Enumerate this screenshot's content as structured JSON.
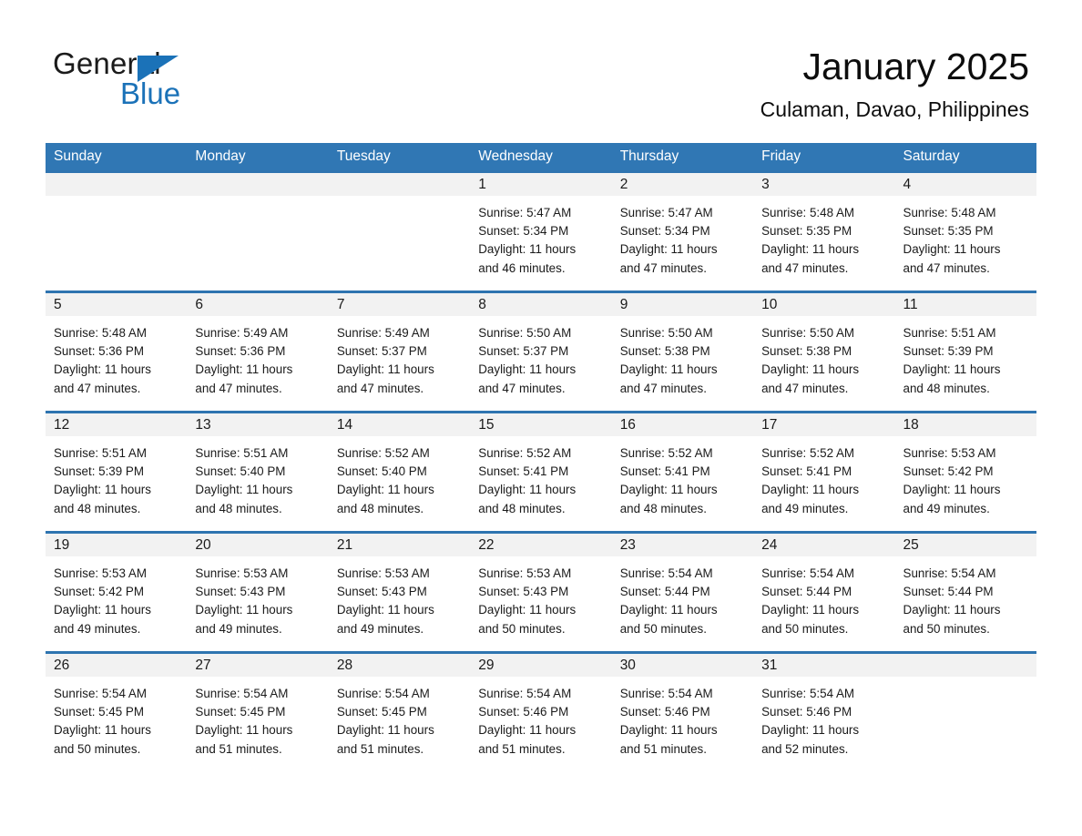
{
  "brand": {
    "line1": "General",
    "line2": "Blue",
    "triangle_icon": "brand-triangle-icon",
    "color_dark": "#1b1b1b",
    "color_blue": "#1b72b8"
  },
  "header": {
    "month_title": "January 2025",
    "location": "Culaman, Davao, Philippines"
  },
  "theme": {
    "header_blue": "#3077b4",
    "row_divider_blue": "#2e74b0",
    "daynum_band": "#f2f2f2",
    "text": "#1a1a1a"
  },
  "weekdays": [
    "Sunday",
    "Monday",
    "Tuesday",
    "Wednesday",
    "Thursday",
    "Friday",
    "Saturday"
  ],
  "labels": {
    "sunrise_prefix": "Sunrise:",
    "sunset_prefix": "Sunset:",
    "daylight_prefix": "Daylight:"
  },
  "weeks": [
    [
      {
        "day": "",
        "line1": "",
        "line2": "",
        "line3": "",
        "line4": ""
      },
      {
        "day": "",
        "line1": "",
        "line2": "",
        "line3": "",
        "line4": ""
      },
      {
        "day": "",
        "line1": "",
        "line2": "",
        "line3": "",
        "line4": ""
      },
      {
        "day": "1",
        "line1": "Sunrise: 5:47 AM",
        "line2": "Sunset: 5:34 PM",
        "line3": "Daylight: 11 hours",
        "line4": "and 46 minutes."
      },
      {
        "day": "2",
        "line1": "Sunrise: 5:47 AM",
        "line2": "Sunset: 5:34 PM",
        "line3": "Daylight: 11 hours",
        "line4": "and 47 minutes."
      },
      {
        "day": "3",
        "line1": "Sunrise: 5:48 AM",
        "line2": "Sunset: 5:35 PM",
        "line3": "Daylight: 11 hours",
        "line4": "and 47 minutes."
      },
      {
        "day": "4",
        "line1": "Sunrise: 5:48 AM",
        "line2": "Sunset: 5:35 PM",
        "line3": "Daylight: 11 hours",
        "line4": "and 47 minutes."
      }
    ],
    [
      {
        "day": "5",
        "line1": "Sunrise: 5:48 AM",
        "line2": "Sunset: 5:36 PM",
        "line3": "Daylight: 11 hours",
        "line4": "and 47 minutes."
      },
      {
        "day": "6",
        "line1": "Sunrise: 5:49 AM",
        "line2": "Sunset: 5:36 PM",
        "line3": "Daylight: 11 hours",
        "line4": "and 47 minutes."
      },
      {
        "day": "7",
        "line1": "Sunrise: 5:49 AM",
        "line2": "Sunset: 5:37 PM",
        "line3": "Daylight: 11 hours",
        "line4": "and 47 minutes."
      },
      {
        "day": "8",
        "line1": "Sunrise: 5:50 AM",
        "line2": "Sunset: 5:37 PM",
        "line3": "Daylight: 11 hours",
        "line4": "and 47 minutes."
      },
      {
        "day": "9",
        "line1": "Sunrise: 5:50 AM",
        "line2": "Sunset: 5:38 PM",
        "line3": "Daylight: 11 hours",
        "line4": "and 47 minutes."
      },
      {
        "day": "10",
        "line1": "Sunrise: 5:50 AM",
        "line2": "Sunset: 5:38 PM",
        "line3": "Daylight: 11 hours",
        "line4": "and 47 minutes."
      },
      {
        "day": "11",
        "line1": "Sunrise: 5:51 AM",
        "line2": "Sunset: 5:39 PM",
        "line3": "Daylight: 11 hours",
        "line4": "and 48 minutes."
      }
    ],
    [
      {
        "day": "12",
        "line1": "Sunrise: 5:51 AM",
        "line2": "Sunset: 5:39 PM",
        "line3": "Daylight: 11 hours",
        "line4": "and 48 minutes."
      },
      {
        "day": "13",
        "line1": "Sunrise: 5:51 AM",
        "line2": "Sunset: 5:40 PM",
        "line3": "Daylight: 11 hours",
        "line4": "and 48 minutes."
      },
      {
        "day": "14",
        "line1": "Sunrise: 5:52 AM",
        "line2": "Sunset: 5:40 PM",
        "line3": "Daylight: 11 hours",
        "line4": "and 48 minutes."
      },
      {
        "day": "15",
        "line1": "Sunrise: 5:52 AM",
        "line2": "Sunset: 5:41 PM",
        "line3": "Daylight: 11 hours",
        "line4": "and 48 minutes."
      },
      {
        "day": "16",
        "line1": "Sunrise: 5:52 AM",
        "line2": "Sunset: 5:41 PM",
        "line3": "Daylight: 11 hours",
        "line4": "and 48 minutes."
      },
      {
        "day": "17",
        "line1": "Sunrise: 5:52 AM",
        "line2": "Sunset: 5:41 PM",
        "line3": "Daylight: 11 hours",
        "line4": "and 49 minutes."
      },
      {
        "day": "18",
        "line1": "Sunrise: 5:53 AM",
        "line2": "Sunset: 5:42 PM",
        "line3": "Daylight: 11 hours",
        "line4": "and 49 minutes."
      }
    ],
    [
      {
        "day": "19",
        "line1": "Sunrise: 5:53 AM",
        "line2": "Sunset: 5:42 PM",
        "line3": "Daylight: 11 hours",
        "line4": "and 49 minutes."
      },
      {
        "day": "20",
        "line1": "Sunrise: 5:53 AM",
        "line2": "Sunset: 5:43 PM",
        "line3": "Daylight: 11 hours",
        "line4": "and 49 minutes."
      },
      {
        "day": "21",
        "line1": "Sunrise: 5:53 AM",
        "line2": "Sunset: 5:43 PM",
        "line3": "Daylight: 11 hours",
        "line4": "and 49 minutes."
      },
      {
        "day": "22",
        "line1": "Sunrise: 5:53 AM",
        "line2": "Sunset: 5:43 PM",
        "line3": "Daylight: 11 hours",
        "line4": "and 50 minutes."
      },
      {
        "day": "23",
        "line1": "Sunrise: 5:54 AM",
        "line2": "Sunset: 5:44 PM",
        "line3": "Daylight: 11 hours",
        "line4": "and 50 minutes."
      },
      {
        "day": "24",
        "line1": "Sunrise: 5:54 AM",
        "line2": "Sunset: 5:44 PM",
        "line3": "Daylight: 11 hours",
        "line4": "and 50 minutes."
      },
      {
        "day": "25",
        "line1": "Sunrise: 5:54 AM",
        "line2": "Sunset: 5:44 PM",
        "line3": "Daylight: 11 hours",
        "line4": "and 50 minutes."
      }
    ],
    [
      {
        "day": "26",
        "line1": "Sunrise: 5:54 AM",
        "line2": "Sunset: 5:45 PM",
        "line3": "Daylight: 11 hours",
        "line4": "and 50 minutes."
      },
      {
        "day": "27",
        "line1": "Sunrise: 5:54 AM",
        "line2": "Sunset: 5:45 PM",
        "line3": "Daylight: 11 hours",
        "line4": "and 51 minutes."
      },
      {
        "day": "28",
        "line1": "Sunrise: 5:54 AM",
        "line2": "Sunset: 5:45 PM",
        "line3": "Daylight: 11 hours",
        "line4": "and 51 minutes."
      },
      {
        "day": "29",
        "line1": "Sunrise: 5:54 AM",
        "line2": "Sunset: 5:46 PM",
        "line3": "Daylight: 11 hours",
        "line4": "and 51 minutes."
      },
      {
        "day": "30",
        "line1": "Sunrise: 5:54 AM",
        "line2": "Sunset: 5:46 PM",
        "line3": "Daylight: 11 hours",
        "line4": "and 51 minutes."
      },
      {
        "day": "31",
        "line1": "Sunrise: 5:54 AM",
        "line2": "Sunset: 5:46 PM",
        "line3": "Daylight: 11 hours",
        "line4": "and 52 minutes."
      },
      {
        "day": "",
        "line1": "",
        "line2": "",
        "line3": "",
        "line4": ""
      }
    ]
  ]
}
